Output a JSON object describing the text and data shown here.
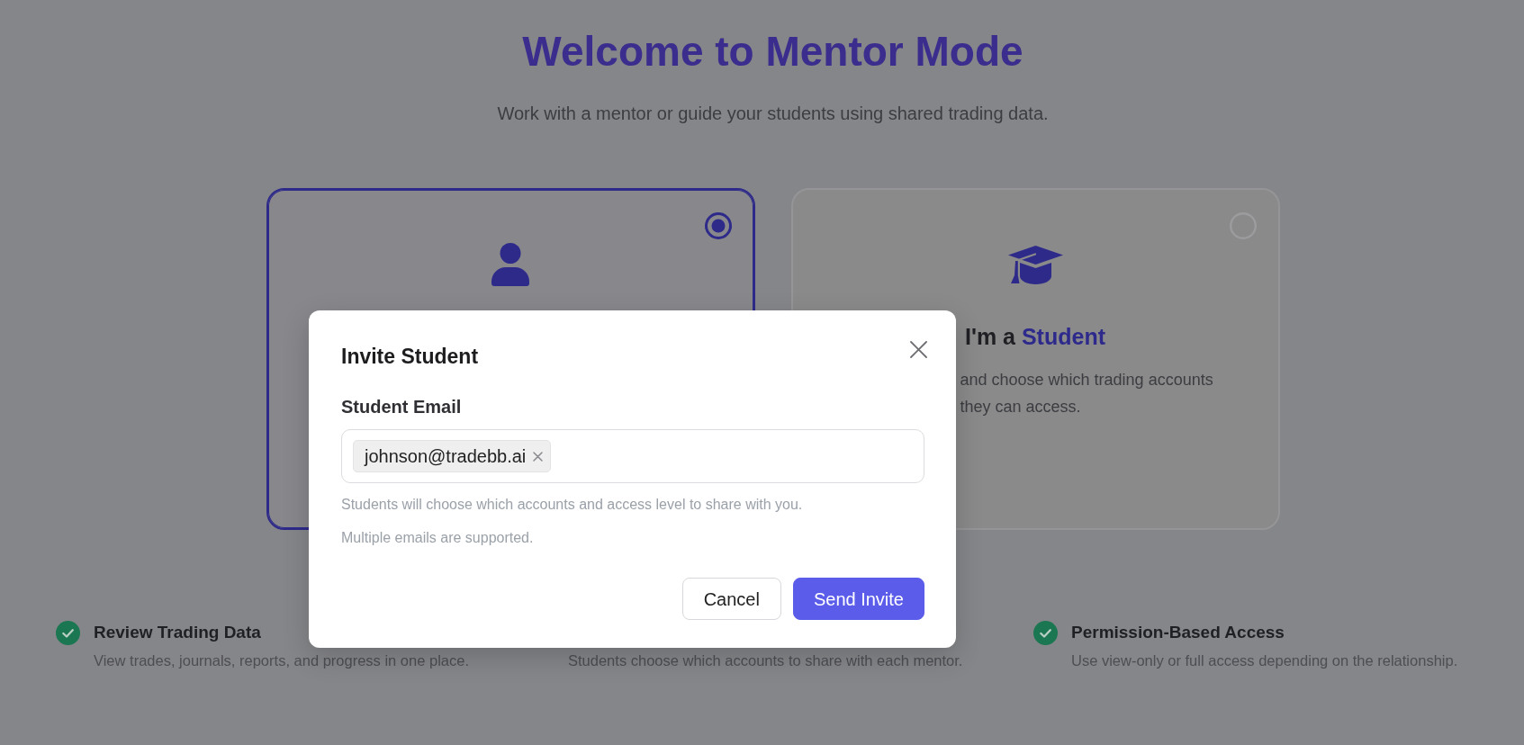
{
  "header": {
    "title": "Welcome to Mentor Mode",
    "subtitle": "Work with a mentor or guide your students using shared trading data."
  },
  "role_cards": [
    {
      "kind": "mentor",
      "selected": true
    },
    {
      "kind": "student",
      "selected": false,
      "title": "I'm a **Student**",
      "description": "and choose which trading accounts they can access."
    }
  ],
  "features": [
    {
      "title": "Review Trading Data",
      "description": "View trades, journals, reports, and progress in one place."
    },
    {
      "description": "Students choose which accounts to share with each mentor."
    },
    {
      "title": "Permission-Based Access",
      "description": "Use view-only or full access depending on the relationship."
    }
  ],
  "dialog": {
    "title": "Invite Student",
    "field_label": "Student Email",
    "emails": [
      "johnson@tradebb.ai"
    ],
    "hints": [
      "Students will choose which accounts and access level to share with you.",
      "Multiple emails are supported."
    ],
    "buttons": [
      {
        "kind": "cancel",
        "label": "Cancel"
      },
      {
        "kind": "submit",
        "label": "Send Invite"
      }
    ]
  }
}
